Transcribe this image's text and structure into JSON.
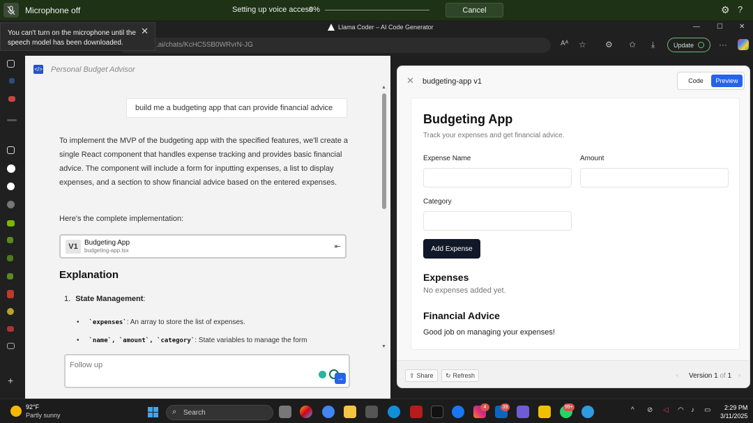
{
  "voice_access": {
    "mic_label": "Microphone off",
    "status": "Setting up voice access",
    "percent": "0%",
    "progress": 0,
    "cancel_label": "Cancel"
  },
  "tooltip": {
    "message": "You can't turn on the microphone until the speech model has been downloaded."
  },
  "browser": {
    "tab_title": "Llama Coder – AI Code Generator",
    "url": ".ai/chats/KcHC5SB0WRvrN-JG",
    "update_label": "Update"
  },
  "chat": {
    "title": "Personal Budget Advisor",
    "user_message": "build me a budgeting app that can provide financial advice",
    "response_intro": "To implement the MVP of the budgeting app with the specified features, we'll create a single React component that handles expense tracking and provides basic financial advice. The component will include a form for inputting expenses, a list to display expenses, and a section to show financial advice based on the entered expenses.",
    "implementation_text": "Here's the complete implementation:",
    "version_card": {
      "badge": "V1",
      "name": "Budgeting App",
      "file": "budgeting-app.tsx"
    },
    "explanation_heading": "Explanation",
    "list_item_number": "1.",
    "list_item_title": "State Management",
    "list_item_colon": ":",
    "bullets": [
      {
        "code": "`expenses`",
        "text": ": An array to store the list of expenses."
      },
      {
        "code": "`name`, `amount`, `category`",
        "text": ": State variables to manage the form"
      }
    ],
    "followup_placeholder": "Follow up"
  },
  "preview": {
    "title": "budgeting-app v1",
    "code_tab": "Code",
    "preview_tab": "Preview",
    "app": {
      "heading": "Budgeting App",
      "subtitle": "Track your expenses and get financial advice.",
      "expense_name_label": "Expense Name",
      "amount_label": "Amount",
      "category_label": "Category",
      "add_button": "Add Expense",
      "expenses_heading": "Expenses",
      "expenses_empty": "No expenses added yet.",
      "advice_heading": "Financial Advice",
      "advice_text": "Good job on managing your expenses!"
    },
    "share_label": "Share",
    "refresh_label": "Refresh",
    "version_label": "Version",
    "version_current": "1",
    "version_of": "of",
    "version_total": "1"
  },
  "taskbar": {
    "temperature": "92°F",
    "weather": "Partly sunny",
    "search_label": "Search",
    "badges": {
      "instagram": "4",
      "linkedin": "39",
      "whatsapp": "99+"
    },
    "time": "2:29 PM",
    "date": "3/11/2025"
  }
}
